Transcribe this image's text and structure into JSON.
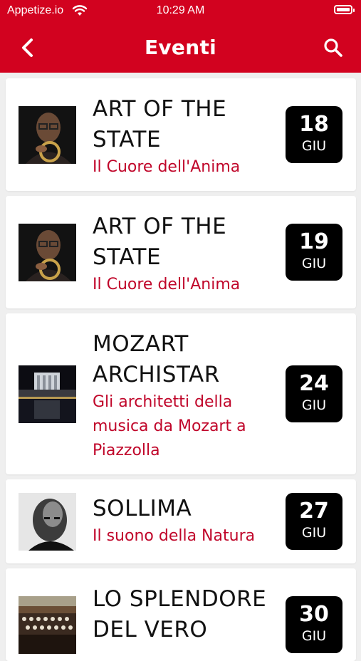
{
  "status_bar": {
    "carrier": "Appetize.io",
    "time": "10:29 AM"
  },
  "nav": {
    "title": "Eventi"
  },
  "colors": {
    "accent": "#d2021f",
    "subtitle": "#c0062a",
    "date_badge": "#000000"
  },
  "events": [
    {
      "title_lines": [
        "ART OF THE",
        "STATE"
      ],
      "subtitle_lines": [
        "Il Cuore dell'Anima"
      ],
      "day": "18",
      "month": "GIU",
      "thumb": "man-with-trumpet"
    },
    {
      "title_lines": [
        "ART OF THE",
        "STATE"
      ],
      "subtitle_lines": [
        "Il Cuore dell'Anima"
      ],
      "day": "19",
      "month": "GIU",
      "thumb": "man-with-trumpet"
    },
    {
      "title_lines": [
        "MOZART",
        "ARCHISTAR"
      ],
      "subtitle_lines": [
        "Gli architetti della",
        "musica da Mozart a",
        "Piazzolla"
      ],
      "day": "24",
      "month": "GIU",
      "thumb": "building-at-night"
    },
    {
      "title_lines": [
        "SOLLIMA"
      ],
      "subtitle_lines": [
        "Il suono della Natura"
      ],
      "day": "27",
      "month": "GIU",
      "thumb": "bald-man-portrait"
    },
    {
      "title_lines": [
        "LO SPLENDORE",
        "DEL VERO"
      ],
      "subtitle_lines": [],
      "day": "30",
      "month": "GIU",
      "thumb": "orchestra-choir"
    }
  ]
}
